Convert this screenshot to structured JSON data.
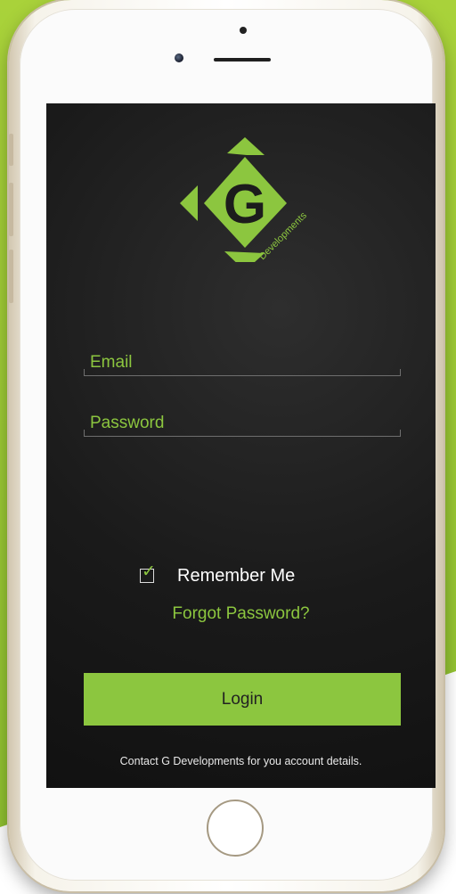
{
  "colors": {
    "accent": "#8cc63f",
    "background": "#1a1a1a",
    "text_light": "#ffffff"
  },
  "logo": {
    "letter": "G",
    "subtitle": "Developments"
  },
  "form": {
    "email_label": "Email",
    "password_label": "Password",
    "remember_me": {
      "label": "Remember Me",
      "checked": true
    },
    "forgot_password": "Forgot Password?",
    "login_button": "Login",
    "contact_note": "Contact G Developments for you account details."
  },
  "icons": {
    "checkbox_mark": "checkmark-icon"
  }
}
